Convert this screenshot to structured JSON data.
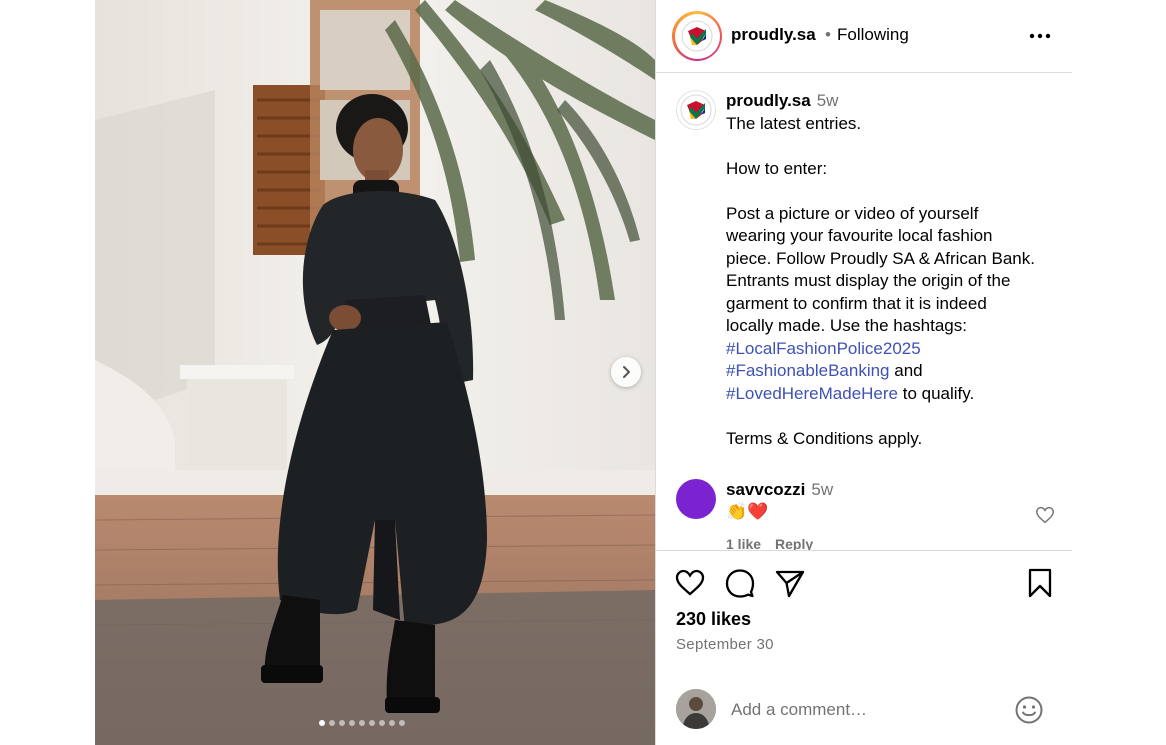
{
  "post": {
    "author": "proudly.sa",
    "follow_status": "Following",
    "separator": "•",
    "media": {
      "image_description_icon": "photo",
      "slide_count": 8,
      "active_slide": 1,
      "next_icon": "chevron-right-icon"
    }
  },
  "caption": {
    "username": "proudly.sa",
    "age": "5w",
    "lines": [
      "The latest entries.",
      "",
      "How to enter:",
      "",
      "Post a picture or video of yourself",
      "wearing your favourite local fashion",
      "piece. Follow Proudly SA & African Bank.",
      "Entrants must display the origin of the",
      "garment to confirm that it is indeed",
      "locally made. Use the hashtags:"
    ],
    "hashtag1": "#LocalFashionPolice2025",
    "hashtag2": "#FashionableBanking",
    "and_text": " and",
    "hashtag3": "#LovedHereMadeHere",
    "qualify_text": " to qualify.",
    "terms": "Terms & Conditions apply."
  },
  "comment": {
    "username": "savvcozzi",
    "age": "5w",
    "text": "👏❤️",
    "likes": "1 like",
    "reply": "Reply"
  },
  "actions": {
    "likes": "230 likes",
    "date": "September 30",
    "placeholder": "Add a comment…"
  },
  "colors": {
    "hashtag": "#3f51b5",
    "muted": "#737373",
    "divider": "#dbdbdb",
    "commenter_avatar": "#7b22d1"
  }
}
